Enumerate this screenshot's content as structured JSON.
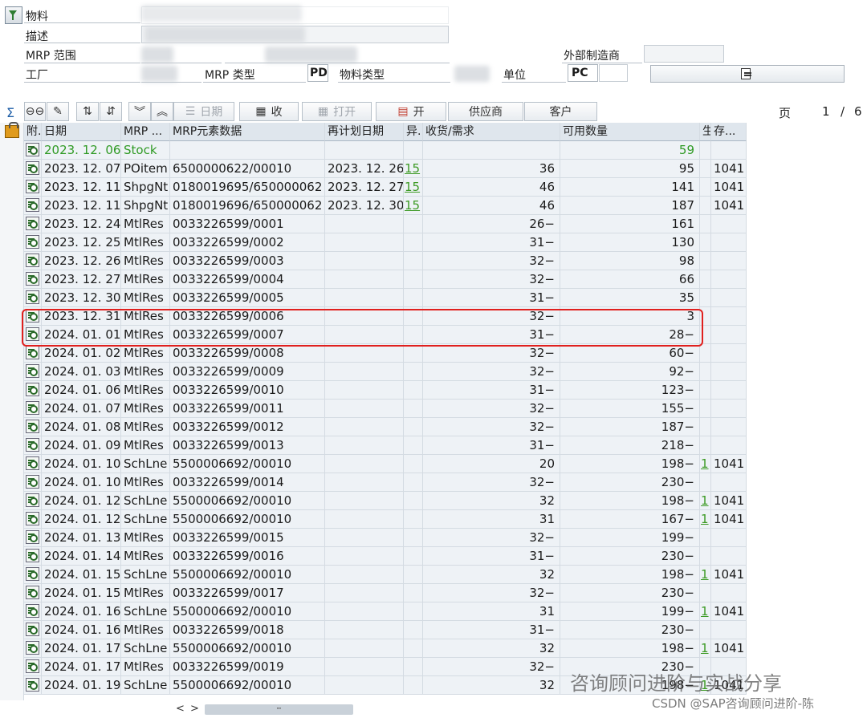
{
  "header": {
    "material_label": "物料",
    "description_label": "描述",
    "mrp_area_label": "MRP 范围",
    "ext_manufacturer_label": "外部制造商",
    "plant_label": "工厂",
    "mrp_type_label": "MRP 类型",
    "mrp_type_value": "PD",
    "material_type_label": "物料类型",
    "unit_label": "单位",
    "unit_value": "PC"
  },
  "toolbar": {
    "sum_icon": "sigma-icon",
    "date_label": "日期",
    "receipt_label": "收",
    "open_label": "打开",
    "open2_label": "开",
    "vendor_label": "供应商",
    "customer_label": "客户",
    "page_label": "页",
    "page_current": "1",
    "page_sep": "/",
    "page_total": "6"
  },
  "table": {
    "columns": [
      "附.",
      "日期",
      "MRP ...",
      "MRP元素数据",
      "再计划日期",
      "异.",
      "收货/需求",
      "可用数量",
      "生",
      "存..."
    ],
    "rows": [
      {
        "date": "2023. 12. 06",
        "mrp": "Stock",
        "data": "",
        "resched": "",
        "exc": "",
        "qty": "",
        "avail": "59",
        "p": "",
        "stor": "",
        "stock": true
      },
      {
        "date": "2023. 12. 07",
        "mrp": "POitem",
        "data": "6500000622/00010",
        "resched": "2023. 12. 26",
        "exc": "15",
        "qty": "36",
        "avail": "95",
        "p": "",
        "stor": "1041"
      },
      {
        "date": "2023. 12. 11",
        "mrp": "ShpgNt",
        "data": "0180019695/650000062",
        "resched": "2023. 12. 27",
        "exc": "15",
        "qty": "46",
        "avail": "141",
        "p": "",
        "stor": "1041"
      },
      {
        "date": "2023. 12. 11",
        "mrp": "ShpgNt",
        "data": "0180019696/650000062",
        "resched": "2023. 12. 30",
        "exc": "15",
        "qty": "46",
        "avail": "187",
        "p": "",
        "stor": "1041"
      },
      {
        "date": "2023. 12. 24",
        "mrp": "MtlRes",
        "data": "0033226599/0001",
        "resched": "",
        "exc": "",
        "qty": "26−",
        "avail": "161",
        "p": "",
        "stor": ""
      },
      {
        "date": "2023. 12. 25",
        "mrp": "MtlRes",
        "data": "0033226599/0002",
        "resched": "",
        "exc": "",
        "qty": "31−",
        "avail": "130",
        "p": "",
        "stor": ""
      },
      {
        "date": "2023. 12. 26",
        "mrp": "MtlRes",
        "data": "0033226599/0003",
        "resched": "",
        "exc": "",
        "qty": "32−",
        "avail": "98",
        "p": "",
        "stor": ""
      },
      {
        "date": "2023. 12. 27",
        "mrp": "MtlRes",
        "data": "0033226599/0004",
        "resched": "",
        "exc": "",
        "qty": "32−",
        "avail": "66",
        "p": "",
        "stor": ""
      },
      {
        "date": "2023. 12. 30",
        "mrp": "MtlRes",
        "data": "0033226599/0005",
        "resched": "",
        "exc": "",
        "qty": "31−",
        "avail": "35",
        "p": "",
        "stor": ""
      },
      {
        "date": "2023. 12. 31",
        "mrp": "MtlRes",
        "data": "0033226599/0006",
        "resched": "",
        "exc": "",
        "qty": "32−",
        "avail": "3",
        "p": "",
        "stor": ""
      },
      {
        "date": "2024. 01. 01",
        "mrp": "MtlRes",
        "data": "0033226599/0007",
        "resched": "",
        "exc": "",
        "qty": "31−",
        "avail": "28−",
        "p": "",
        "stor": ""
      },
      {
        "date": "2024. 01. 02",
        "mrp": "MtlRes",
        "data": "0033226599/0008",
        "resched": "",
        "exc": "",
        "qty": "32−",
        "avail": "60−",
        "p": "",
        "stor": ""
      },
      {
        "date": "2024. 01. 03",
        "mrp": "MtlRes",
        "data": "0033226599/0009",
        "resched": "",
        "exc": "",
        "qty": "32−",
        "avail": "92−",
        "p": "",
        "stor": ""
      },
      {
        "date": "2024. 01. 06",
        "mrp": "MtlRes",
        "data": "0033226599/0010",
        "resched": "",
        "exc": "",
        "qty": "31−",
        "avail": "123−",
        "p": "",
        "stor": ""
      },
      {
        "date": "2024. 01. 07",
        "mrp": "MtlRes",
        "data": "0033226599/0011",
        "resched": "",
        "exc": "",
        "qty": "32−",
        "avail": "155−",
        "p": "",
        "stor": ""
      },
      {
        "date": "2024. 01. 08",
        "mrp": "MtlRes",
        "data": "0033226599/0012",
        "resched": "",
        "exc": "",
        "qty": "32−",
        "avail": "187−",
        "p": "",
        "stor": ""
      },
      {
        "date": "2024. 01. 09",
        "mrp": "MtlRes",
        "data": "0033226599/0013",
        "resched": "",
        "exc": "",
        "qty": "31−",
        "avail": "218−",
        "p": "",
        "stor": ""
      },
      {
        "date": "2024. 01. 10",
        "mrp": "SchLne",
        "data": "5500006692/00010",
        "resched": "",
        "exc": "",
        "qty": "20",
        "avail": "198−",
        "p": "1",
        "stor": "1041"
      },
      {
        "date": "2024. 01. 10",
        "mrp": "MtlRes",
        "data": "0033226599/0014",
        "resched": "",
        "exc": "",
        "qty": "32−",
        "avail": "230−",
        "p": "",
        "stor": ""
      },
      {
        "date": "2024. 01. 12",
        "mrp": "SchLne",
        "data": "5500006692/00010",
        "resched": "",
        "exc": "",
        "qty": "32",
        "avail": "198−",
        "p": "1",
        "stor": "1041"
      },
      {
        "date": "2024. 01. 12",
        "mrp": "SchLne",
        "data": "5500006692/00010",
        "resched": "",
        "exc": "",
        "qty": "31",
        "avail": "167−",
        "p": "1",
        "stor": "1041"
      },
      {
        "date": "2024. 01. 13",
        "mrp": "MtlRes",
        "data": "0033226599/0015",
        "resched": "",
        "exc": "",
        "qty": "32−",
        "avail": "199−",
        "p": "",
        "stor": ""
      },
      {
        "date": "2024. 01. 14",
        "mrp": "MtlRes",
        "data": "0033226599/0016",
        "resched": "",
        "exc": "",
        "qty": "31−",
        "avail": "230−",
        "p": "",
        "stor": ""
      },
      {
        "date": "2024. 01. 15",
        "mrp": "SchLne",
        "data": "5500006692/00010",
        "resched": "",
        "exc": "",
        "qty": "32",
        "avail": "198−",
        "p": "1",
        "stor": "1041"
      },
      {
        "date": "2024. 01. 15",
        "mrp": "MtlRes",
        "data": "0033226599/0017",
        "resched": "",
        "exc": "",
        "qty": "32−",
        "avail": "230−",
        "p": "",
        "stor": ""
      },
      {
        "date": "2024. 01. 16",
        "mrp": "SchLne",
        "data": "5500006692/00010",
        "resched": "",
        "exc": "",
        "qty": "31",
        "avail": "199−",
        "p": "1",
        "stor": "1041"
      },
      {
        "date": "2024. 01. 16",
        "mrp": "MtlRes",
        "data": "0033226599/0018",
        "resched": "",
        "exc": "",
        "qty": "31−",
        "avail": "230−",
        "p": "",
        "stor": ""
      },
      {
        "date": "2024. 01. 17",
        "mrp": "SchLne",
        "data": "5500006692/00010",
        "resched": "",
        "exc": "",
        "qty": "32",
        "avail": "198−",
        "p": "1",
        "stor": "1041"
      },
      {
        "date": "2024. 01. 17",
        "mrp": "MtlRes",
        "data": "0033226599/0019",
        "resched": "",
        "exc": "",
        "qty": "32−",
        "avail": "230−",
        "p": "",
        "stor": ""
      },
      {
        "date": "2024. 01. 19",
        "mrp": "SchLne",
        "data": "5500006692/00010",
        "resched": "",
        "exc": "",
        "qty": "32",
        "avail": "198−",
        "p": "1",
        "stor": "1041"
      }
    ]
  },
  "scrollbar": {
    "left_arrow": "<",
    "right_arrow": ">",
    "thumb_glyph": "┅"
  },
  "watermark": {
    "line1": "咨询顾问进阶与实战分享",
    "line2": "CSDN @SAP咨询顾问进阶-陈"
  },
  "colors": {
    "stock_green": "#2f9a24",
    "highlight_red": "#e0201e",
    "grid_bg": "#eef2f6"
  }
}
